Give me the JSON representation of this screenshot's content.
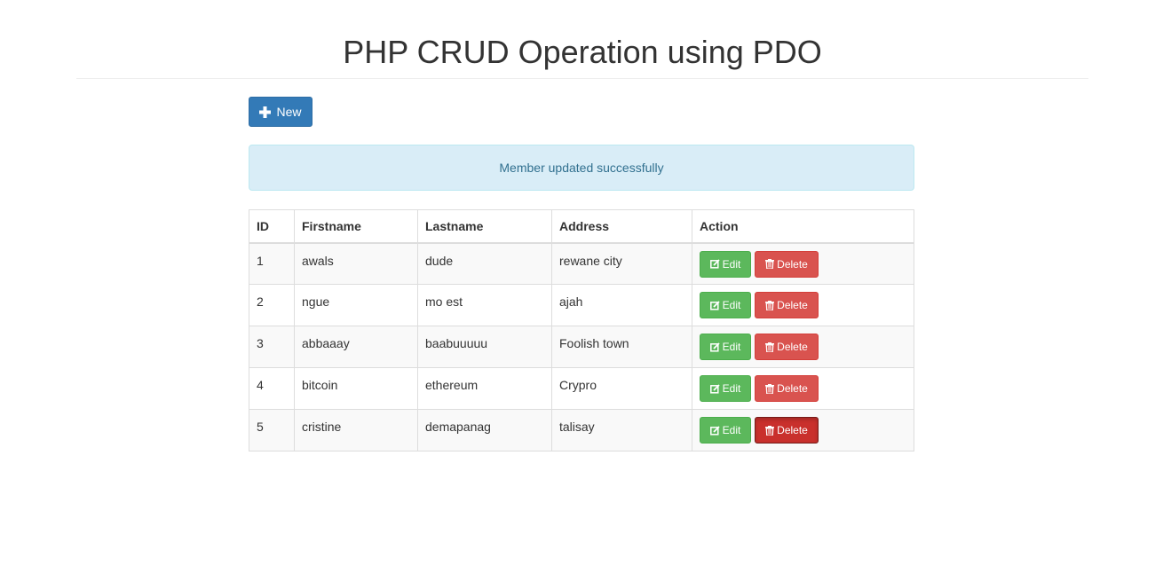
{
  "page": {
    "title": "PHP CRUD Operation using PDO"
  },
  "toolbar": {
    "new_label": "New",
    "new_icon": "plus-icon"
  },
  "alert": {
    "message": "Member updated successfully",
    "type": "info"
  },
  "table": {
    "headers": {
      "id": "ID",
      "firstname": "Firstname",
      "lastname": "Lastname",
      "address": "Address",
      "action": "Action"
    },
    "rows": [
      {
        "id": "1",
        "firstname": "awals",
        "lastname": "dude",
        "address": "rewane city"
      },
      {
        "id": "2",
        "firstname": "ngue",
        "lastname": "mo est",
        "address": "ajah"
      },
      {
        "id": "3",
        "firstname": "abbaaay",
        "lastname": "baabuuuuu",
        "address": "Foolish town"
      },
      {
        "id": "4",
        "firstname": "bitcoin",
        "lastname": "ethereum",
        "address": "Crypro"
      },
      {
        "id": "5",
        "firstname": "cristine",
        "lastname": "demapanag",
        "address": "talisay"
      }
    ],
    "edit_label": "Edit",
    "delete_label": "Delete",
    "edit_icon": "edit-icon",
    "delete_icon": "trash-icon"
  },
  "colors": {
    "primary": "#337ab7",
    "success": "#5cb85c",
    "danger": "#d9534f",
    "danger_active": "#c9302c",
    "info_bg": "#d9edf7",
    "info_text": "#31708f"
  }
}
